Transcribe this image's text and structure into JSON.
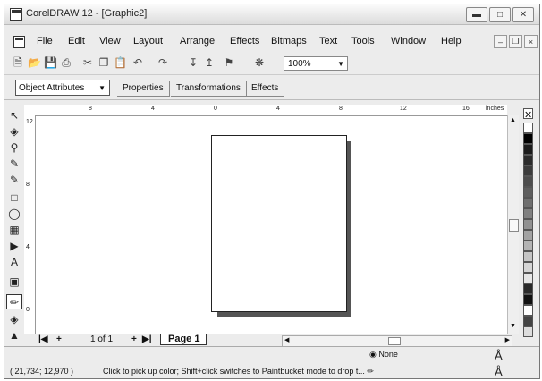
{
  "window": {
    "title": "CorelDRAW 12 - [Graphic2]"
  },
  "menu": [
    "File",
    "Edit",
    "View",
    "Layout",
    "Arrange",
    "Effects",
    "Bitmaps",
    "Text",
    "Tools",
    "Window",
    "Help"
  ],
  "toolbar": {
    "zoom_value": "100%"
  },
  "propertybar": {
    "object_combo": "Object Attributes",
    "tabs": [
      "Properties",
      "Transformations",
      "Effects"
    ]
  },
  "ruler": {
    "h_labels": [
      "8",
      "4",
      "0",
      "4",
      "8",
      "12",
      "16"
    ],
    "units": "inches",
    "v_labels": [
      "12",
      "8",
      "4",
      "0"
    ],
    "v_units": "inches"
  },
  "pages": {
    "counter": "1 of 1",
    "tab": "Page 1"
  },
  "status": {
    "fill": "None",
    "coords": "( 21,734; 12,970 )",
    "hint": "Click to pick up color; Shift+click switches to Paintbucket mode to drop t..."
  },
  "palette": [
    "#ffffff",
    "#000000",
    "#1c1c1c",
    "#2c2c2c",
    "#3c3c3c",
    "#4d4d4d",
    "#5e5e5e",
    "#6f6f6f",
    "#808080",
    "#919191",
    "#a2a2a2",
    "#b3b3b3",
    "#c4c4c4",
    "#d5d5d5",
    "#e6e6e6",
    "#2a2a2a",
    "#111111",
    "#ffffff",
    "#444444",
    "#dddddd"
  ],
  "icons": {
    "window_minimize": "minimize-icon",
    "window_maximize": "maximize-icon",
    "window_close": "close-icon"
  }
}
